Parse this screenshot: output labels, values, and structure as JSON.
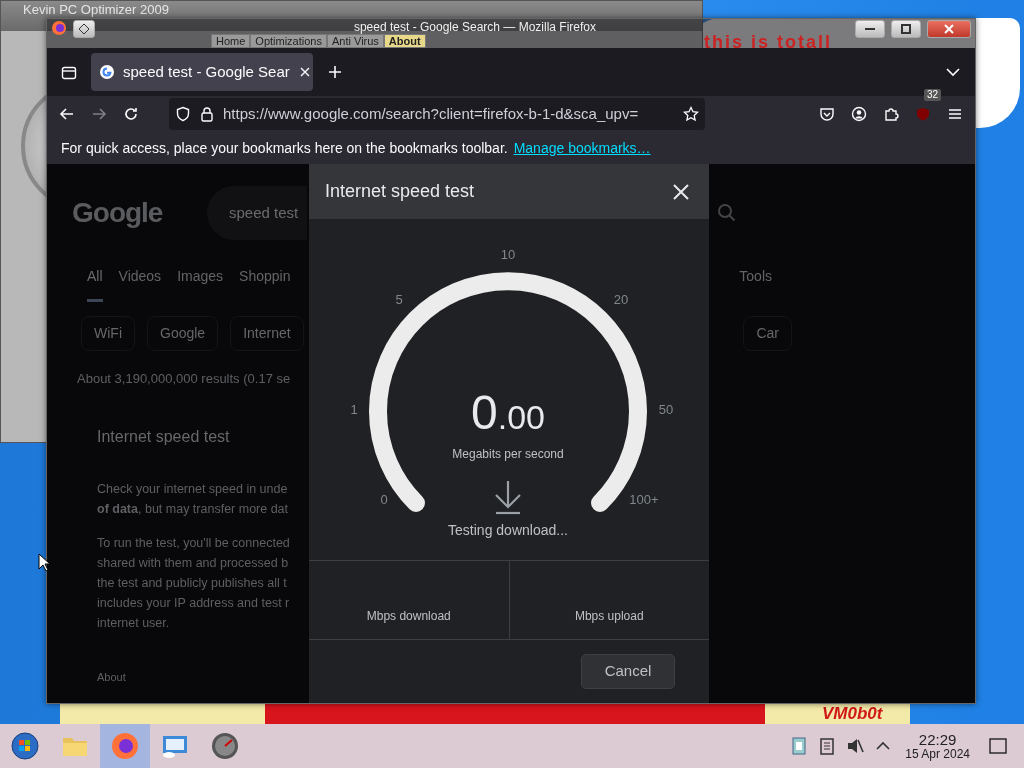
{
  "desktop": {
    "wallpaper_text": "VM0b0t",
    "note_text": "this is totall"
  },
  "back_window": {
    "title": "Kevin PC Optimizer 2009",
    "tabs": [
      {
        "label": "Home",
        "selected": false
      },
      {
        "label": "Optimizations",
        "selected": false
      },
      {
        "label": "Anti Virus",
        "selected": false
      },
      {
        "label": "About",
        "selected": true
      }
    ]
  },
  "browser": {
    "title": "speed test - Google Search — Mozilla Firefox",
    "tabs": [
      {
        "label": "speed test - Google Sear",
        "selected": true
      }
    ],
    "url": "https://www.google.com/search?client=firefox-b-1-d&sca_upv=",
    "forward_disabled": true,
    "extension_badge": "32",
    "bookmarks_message": "For quick access, place your bookmarks here on the bookmarks toolbar.",
    "bookmarks_link": "Manage bookmarks…"
  },
  "page": {
    "logo": "Google",
    "query": "speed test",
    "tabs": [
      {
        "label": "All",
        "selected": true
      },
      {
        "label": "Videos",
        "selected": false
      },
      {
        "label": "Images",
        "selected": false
      },
      {
        "label": "Shoppin",
        "selected": false
      },
      {
        "label": "Tools",
        "selected": false
      }
    ],
    "chips": [
      "WiFi",
      "Google",
      "Internet",
      "Car"
    ],
    "results_count": "About 3,190,000,000 results (0.17 se",
    "card_title": "Internet speed test",
    "paragraphs": [
      [
        "Check your internet speed in unde",
        "**of data**, but may transfer more dat"
      ],
      [
        "To run the test, you'll be connected",
        "shared with them and processed b",
        "the test and publicly publishes all t",
        "includes your IP address and test r",
        "internet user."
      ]
    ],
    "about_link": "About"
  },
  "dialog": {
    "title": "Internet speed test",
    "gauge_labels": [
      "0",
      "1",
      "5",
      "10",
      "20",
      "50",
      "100+"
    ],
    "speed": "0.00",
    "unit": "Megabits per second",
    "status": "Testing download...",
    "results": [
      {
        "label": "Mbps download"
      },
      {
        "label": "Mbps upload"
      }
    ],
    "cancel": "Cancel"
  },
  "taskbar": {
    "apps": [
      {
        "kind": "start",
        "selected": false
      },
      {
        "kind": "folder",
        "selected": false
      },
      {
        "kind": "firefox",
        "selected": true
      },
      {
        "kind": "monitor",
        "selected": false
      },
      {
        "kind": "gauge",
        "selected": false
      }
    ],
    "tray": [
      {
        "kind": "clipboard"
      },
      {
        "kind": "notes"
      },
      {
        "kind": "speaker",
        "muted": true
      },
      {
        "kind": "expand"
      }
    ],
    "time": "22:29",
    "date": "15 Apr 2024"
  }
}
